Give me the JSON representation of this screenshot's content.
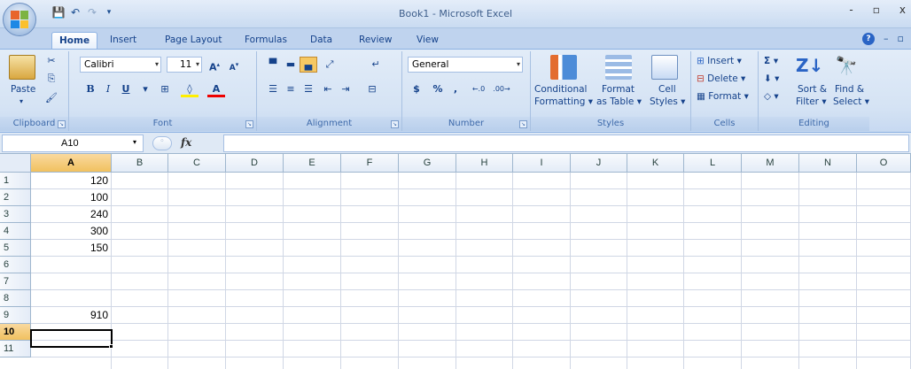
{
  "window": {
    "title": "Book1 - Microsoft Excel",
    "controls": [
      "-",
      "▫",
      "x"
    ]
  },
  "qat": {
    "save_icon": "save-icon",
    "undo_icon": "undo-icon",
    "redo_icon": "redo-icon"
  },
  "tabs": [
    "Home",
    "Insert",
    "Page Layout",
    "Formulas",
    "Data",
    "Review",
    "View"
  ],
  "ribbon": {
    "clipboard": {
      "paste": "Paste",
      "label": "Clipboard"
    },
    "font": {
      "name": "Calibri",
      "size": "11",
      "bold": "B",
      "italic": "I",
      "underline": "U",
      "label": "Font"
    },
    "alignment": {
      "label": "Alignment"
    },
    "number": {
      "format": "General",
      "currency": "$",
      "percent": "%",
      "comma": ",",
      "label": "Number"
    },
    "styles": {
      "conditional": "Conditional",
      "conditional2": "Formatting ▾",
      "format_table": "Format",
      "format_table2": "as Table ▾",
      "cell": "Cell",
      "cell2": "Styles ▾",
      "label": "Styles"
    },
    "cells": {
      "insert": "Insert ▾",
      "delete": "Delete ▾",
      "format": "Format ▾",
      "label": "Cells"
    },
    "editing": {
      "sigma": "Σ ▾",
      "sort": "Sort &",
      "sort2": "Filter ▾",
      "find": "Find &",
      "find2": "Select ▾",
      "label": "Editing"
    }
  },
  "formula_bar": {
    "name_box": "A10",
    "fx": "fx",
    "formula": ""
  },
  "sheet": {
    "columns": [
      "A",
      "B",
      "C",
      "D",
      "E",
      "F",
      "G",
      "H",
      "I",
      "J",
      "K",
      "L",
      "M",
      "N",
      "O"
    ],
    "rows": [
      "1",
      "2",
      "3",
      "4",
      "5",
      "6",
      "7",
      "8",
      "9",
      "10",
      "11"
    ],
    "column_a_values": [
      "120",
      "100",
      "240",
      "300",
      "150",
      "",
      "",
      "",
      "910",
      "",
      ""
    ],
    "active_cell": "A10"
  },
  "colors": {
    "ribbon": "#d5e3f4",
    "accent": "#15428b",
    "selection": "#f1c15f"
  }
}
